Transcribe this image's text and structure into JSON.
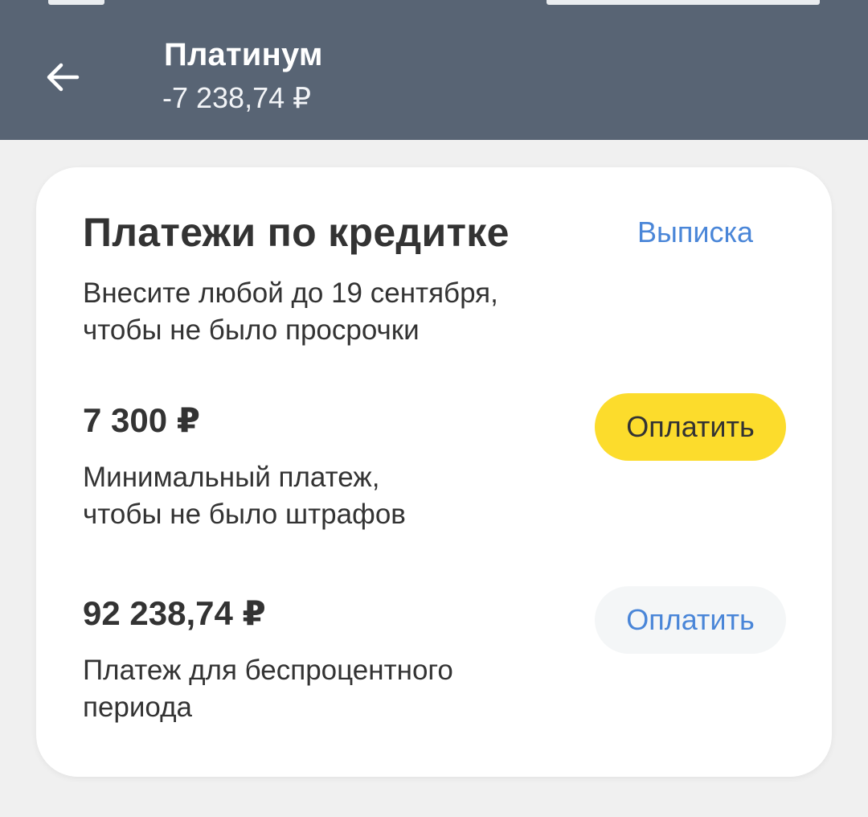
{
  "header": {
    "back_icon": "arrow-left-icon",
    "title": "Платинум",
    "balance": "-7 238,74 ₽"
  },
  "card": {
    "title": "Платежи по кредитке",
    "statement_link": "Выписка",
    "subtitle_line1": "Внесите любой до 19 сентября,",
    "subtitle_line2": "чтобы не было просрочки",
    "payments": [
      {
        "amount": "7 300 ₽",
        "desc_line1": "Минимальный платеж,",
        "desc_line2": "чтобы не было штрафов",
        "button_label": "Оплатить"
      },
      {
        "amount": "92 238,74 ₽",
        "desc_line1": "Платеж для беспроцентного",
        "desc_line2": "периода",
        "button_label": "Оплатить"
      }
    ]
  },
  "colors": {
    "header_bg": "#586474",
    "accent_blue": "#4a86d8",
    "primary_button": "#fcdc2c",
    "secondary_button": "#f4f6f7"
  }
}
